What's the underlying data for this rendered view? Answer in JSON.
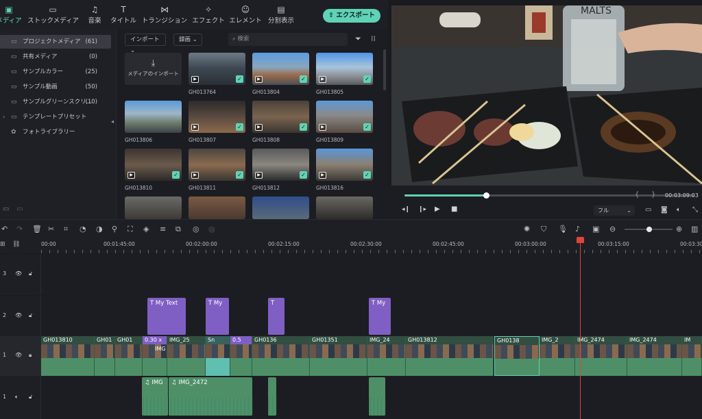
{
  "tabs": [
    {
      "label": "メディア",
      "icon": "image-icon"
    },
    {
      "label": "ストックメディア",
      "icon": "stock-icon"
    },
    {
      "label": "音楽",
      "icon": "music-icon"
    },
    {
      "label": "タイトル",
      "icon": "title-icon"
    },
    {
      "label": "トランジション",
      "icon": "transition-icon"
    },
    {
      "label": "エフェクト",
      "icon": "effect-icon"
    },
    {
      "label": "エレメント",
      "icon": "element-icon"
    },
    {
      "label": "分割表示",
      "icon": "split-icon"
    }
  ],
  "export_label": "エクスポート",
  "sidebar": {
    "items": [
      {
        "label": "プロジェクトメディア",
        "count": "(61)"
      },
      {
        "label": "共有メディア",
        "count": "(0)"
      },
      {
        "label": "サンプルカラー",
        "count": "(25)"
      },
      {
        "label": "サンプル動画",
        "count": "(50)"
      },
      {
        "label": "サンプルグリーンスクリ…",
        "count": "(10)"
      },
      {
        "label": "テンプレートプリセット",
        "count": ""
      },
      {
        "label": "フォトライブラリー",
        "count": ""
      }
    ]
  },
  "media": {
    "import_dropdown": "インポート",
    "record_dropdown": "録画",
    "search_placeholder": "検索",
    "import_box_label": "メディアのインポート",
    "items": [
      "GH013764",
      "GH013804",
      "GH013805",
      "GH013806",
      "GH013807",
      "GH013808",
      "GH013809",
      "GH013810",
      "GH013811",
      "GH013812",
      "GH013816"
    ]
  },
  "player": {
    "time": "00:03:09:03",
    "quality": "フル",
    "progress": 0.28
  },
  "ruler": {
    "labels": [
      "00:00",
      "00:01:45:00",
      "00:02:00:00",
      "00:02:15:00",
      "00:02:30:00",
      "00:02:45:00",
      "00:03:00:00",
      "00:03:15:00",
      "00:03:30"
    ]
  },
  "tracks": {
    "labels": [
      "3",
      "2",
      "1",
      "1"
    ],
    "titles": [
      "My Text",
      "My",
      "T",
      "My"
    ],
    "video": [
      "GH013810",
      "GH01",
      "0.30 x",
      "IMG_25",
      "Sn",
      "0.5",
      "GH0136",
      "GH01351",
      "IMG_24",
      "GH013812",
      "GH0138",
      "IMG_2",
      "IMG_2474",
      "IMG_2474",
      "IM"
    ],
    "video_sub": [
      "IMG",
      "IMG"
    ],
    "audio": [
      "IMG",
      "IMG_2472"
    ]
  },
  "colors": {
    "accent": "#5fd3b5",
    "title_clip": "#7f5fc4",
    "clip": "#4e8f68",
    "playhead": "#e0443b"
  }
}
